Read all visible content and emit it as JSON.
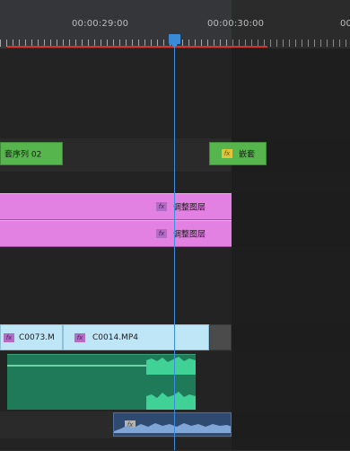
{
  "ruler": {
    "timecode_1": "00:00:29:00",
    "timecode_2": "00:00:30:00",
    "timecode_3": "00"
  },
  "clips": {
    "nested_seq_label": "套序列 02",
    "nested_label": "嵌套",
    "adjustment_layer_1": "调整图层",
    "adjustment_layer_2": "调整图层",
    "clip_c0073": "C0073.M",
    "clip_c0014": "C0014.MP4",
    "fx_badge": "fx"
  },
  "colors": {
    "playhead": "#3c8ee0",
    "work_area_bar": "#d4322b",
    "nested_clip": "#57b54d",
    "adjustment_clip": "#e281e2",
    "video_clip": "#bfe6f7",
    "audio_clip": "#1f7a5a"
  }
}
